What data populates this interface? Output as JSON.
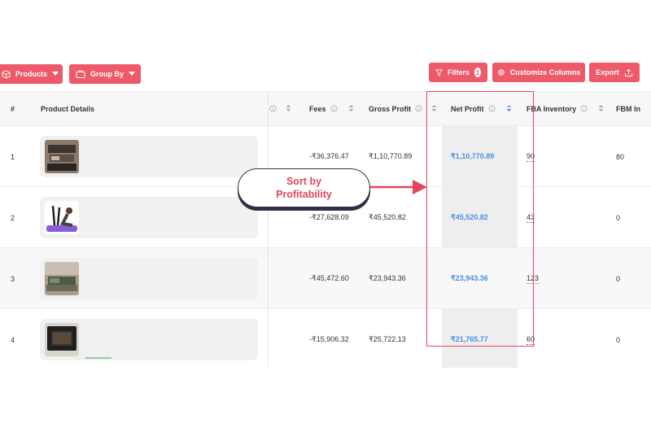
{
  "toolbar": {
    "products_label": "Products",
    "groupby_label": "Group By",
    "filters_label": "Filters",
    "filters_count": "1",
    "columns_label": "Customize Columns",
    "export_label": "Export"
  },
  "table": {
    "headers": {
      "index": "#",
      "product_details": "Product Details",
      "fees": "Fees",
      "gross_profit": "Gross Profit",
      "net_profit": "Net Profit",
      "fba_inventory": "FBA Inventory",
      "fbm_inventory": "FBM In"
    },
    "rows": [
      {
        "index": "1",
        "fees": "-₹36,376.47",
        "gross_profit": "₹1,10,770.89",
        "net_profit": "₹1,10,770.89",
        "fba": "90",
        "fbm": "80"
      },
      {
        "index": "2",
        "fees": "-₹27,628.09",
        "gross_profit": "₹45,520.82",
        "net_profit": "₹45,520.82",
        "fba": "43",
        "fbm": "0"
      },
      {
        "index": "3",
        "fees": "-₹45,472.60",
        "gross_profit": "₹23,943.36",
        "net_profit": "₹23,943.36",
        "fba": "123",
        "fbm": "0"
      },
      {
        "index": "4",
        "fees": "-₹15,906.32",
        "gross_profit": "₹25,722.13",
        "net_profit": "₹21,765.77",
        "fba": "60",
        "fbm": "0"
      }
    ]
  },
  "callout": {
    "line1": "Sort by",
    "line2": "Profitability"
  },
  "colors": {
    "accent": "#ee5a6a",
    "highlight": "#e2475b",
    "net_profit_text": "#4a90e2",
    "callout_border": "#2c3149"
  }
}
